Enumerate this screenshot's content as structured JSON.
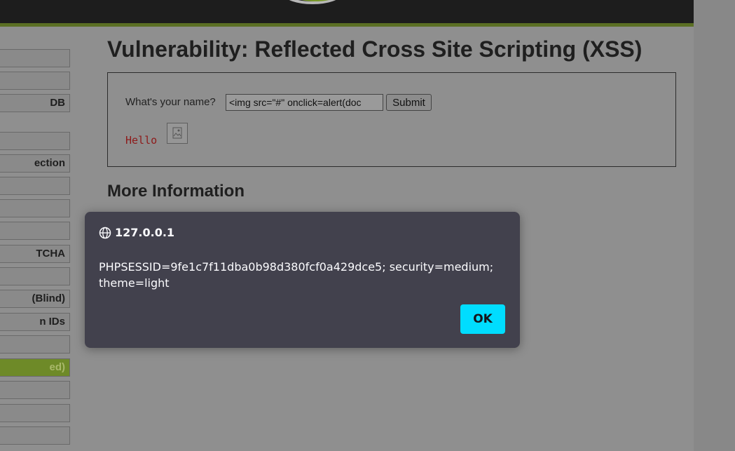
{
  "page": {
    "title": "Vulnerability: Reflected Cross Site Scripting (XSS)",
    "more_info_heading": "More Information"
  },
  "sidebar": {
    "items": [
      {
        "label": ""
      },
      {
        "label": ""
      },
      {
        "label": "DB"
      },
      {
        "label": ""
      },
      {
        "label": "ection"
      },
      {
        "label": ""
      },
      {
        "label": ""
      },
      {
        "label": ""
      },
      {
        "label": "TCHA"
      },
      {
        "label": ""
      },
      {
        "label": "(Blind)"
      },
      {
        "label": "n IDs"
      },
      {
        "label": ""
      },
      {
        "label": "ed)",
        "active": true
      },
      {
        "label": ""
      },
      {
        "label": ""
      },
      {
        "label": ""
      }
    ]
  },
  "form": {
    "label": "What's your name?",
    "input_value": "<img src=\"#\" onclick=alert(doc",
    "submit_label": "Submit"
  },
  "output": {
    "hello_text": "Hello"
  },
  "dialog": {
    "origin": "127.0.0.1",
    "message": "PHPSESSID=9fe1c7f11dba0b98d380fcf0a429dce5; security=medium; theme=light",
    "ok_label": "OK"
  },
  "colors": {
    "accent_ok": "#00ddff",
    "active_menu": "#6e8a28",
    "hello_text": "#8e1a1a"
  },
  "icons": {
    "origin": "globe-icon",
    "broken_image": "broken-image-icon"
  }
}
